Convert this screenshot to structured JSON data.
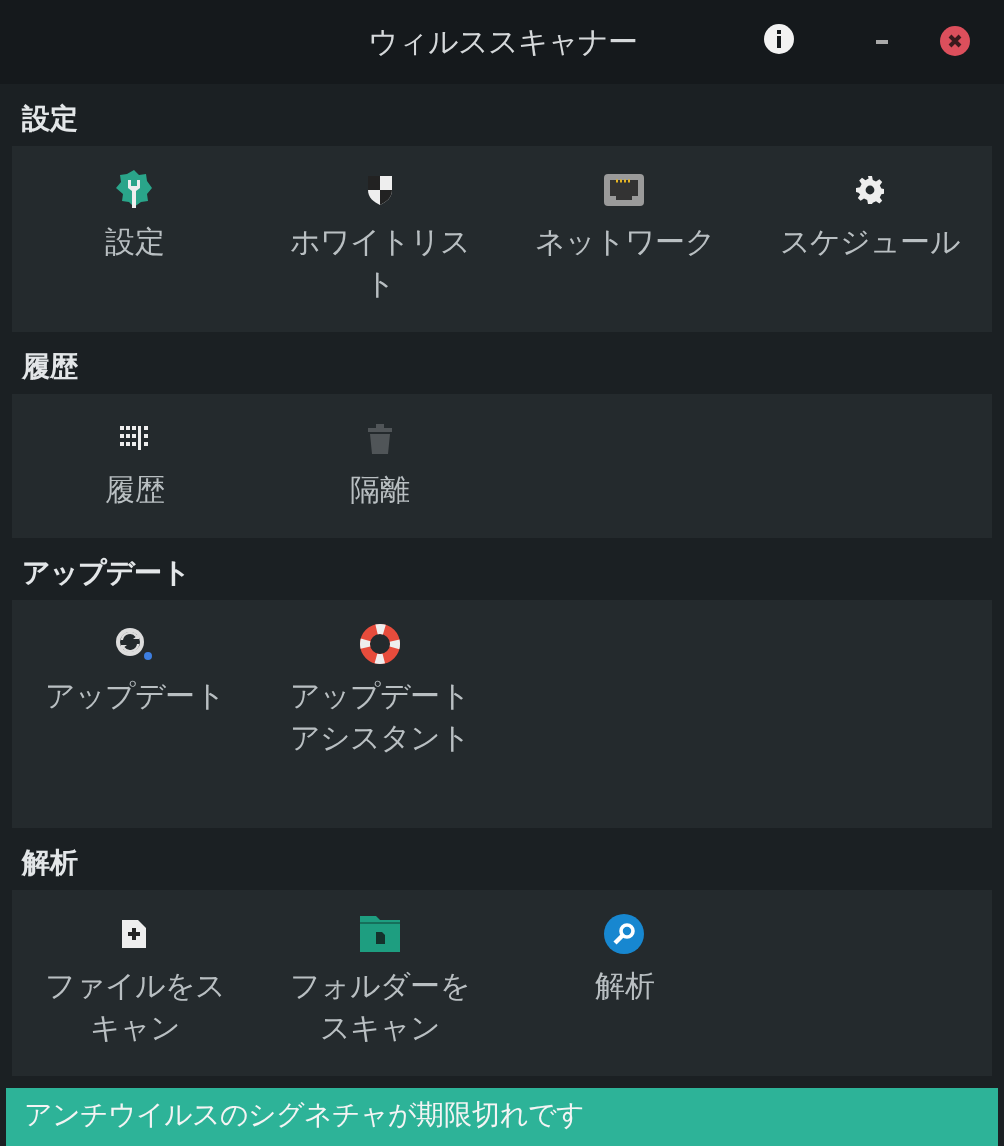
{
  "window": {
    "title": "ウィルススキャナー"
  },
  "sections": [
    {
      "title": "設定",
      "items": [
        {
          "label": "設定"
        },
        {
          "label": "ホワイトリスト"
        },
        {
          "label": "ネットワーク"
        },
        {
          "label": "スケジュール"
        }
      ]
    },
    {
      "title": "履歴",
      "items": [
        {
          "label": "履歴"
        },
        {
          "label": "隔離"
        }
      ]
    },
    {
      "title": "アップデート",
      "items": [
        {
          "label": "アップデート"
        },
        {
          "label": "アップデートアシスタント"
        }
      ]
    },
    {
      "title": "解析",
      "items": [
        {
          "label": "ファイルをスキャン"
        },
        {
          "label": "フォルダーをスキャン"
        },
        {
          "label": "解析"
        }
      ]
    }
  ],
  "status_bar": {
    "text": "アンチウイルスのシグネチャが期限切れです"
  }
}
